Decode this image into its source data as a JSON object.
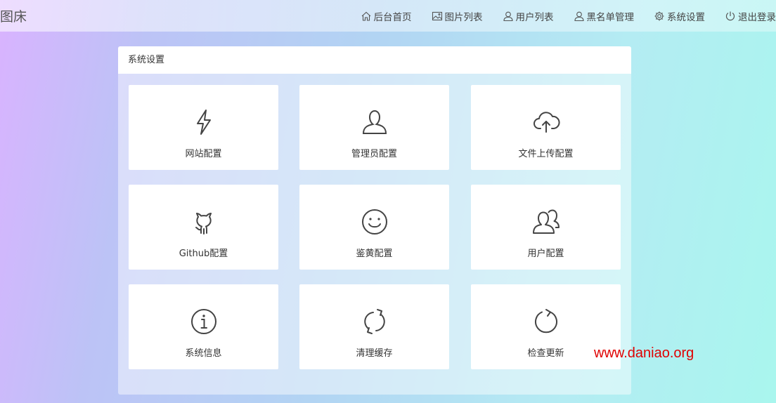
{
  "header": {
    "brand": "图床",
    "nav": [
      {
        "label": "后台首页",
        "icon": "home-icon"
      },
      {
        "label": "图片列表",
        "icon": "image-icon"
      },
      {
        "label": "用户列表",
        "icon": "user-icon"
      },
      {
        "label": "黑名单管理",
        "icon": "user-block-icon"
      },
      {
        "label": "系统设置",
        "icon": "gear-icon"
      },
      {
        "label": "退出登录",
        "icon": "power-icon"
      }
    ]
  },
  "panel": {
    "title": "系统设置",
    "cards": [
      {
        "label": "网站配置",
        "icon": "lightning-icon"
      },
      {
        "label": "管理员配置",
        "icon": "user-icon"
      },
      {
        "label": "文件上传配置",
        "icon": "cloud-upload-icon"
      },
      {
        "label": "Github配置",
        "icon": "github-icon"
      },
      {
        "label": "鉴黄配置",
        "icon": "smile-icon"
      },
      {
        "label": "用户配置",
        "icon": "users-icon"
      },
      {
        "label": "系统信息",
        "icon": "info-icon"
      },
      {
        "label": "清理缓存",
        "icon": "refresh-icon"
      },
      {
        "label": "检查更新",
        "icon": "reload-icon"
      }
    ]
  },
  "watermark": "www.daniao.org"
}
